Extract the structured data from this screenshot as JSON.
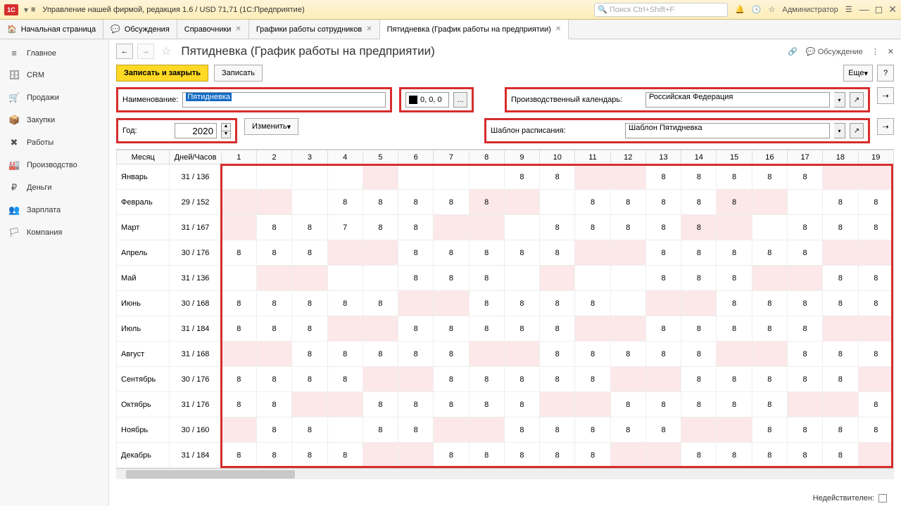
{
  "title": "Управление нашей фирмой, редакция 1.6 / USD 71,71  (1С:Предприятие)",
  "search_placeholder": "Поиск Ctrl+Shift+F",
  "user": "Администратор",
  "tabs": [
    {
      "label": "Начальная страница",
      "closable": false,
      "icon": "🏠"
    },
    {
      "label": "Обсуждения",
      "closable": false,
      "icon": "💬"
    },
    {
      "label": "Справочники",
      "closable": true,
      "icon": ""
    },
    {
      "label": "Графики работы сотрудников",
      "closable": true,
      "icon": ""
    },
    {
      "label": "Пятидневка (График работы на предприятии)",
      "closable": true,
      "icon": "",
      "active": true
    }
  ],
  "sidebar": [
    {
      "icon": "≡",
      "label": "Главное"
    },
    {
      "icon": "🗄",
      "label": "CRM"
    },
    {
      "icon": "🛒",
      "label": "Продажи"
    },
    {
      "icon": "📦",
      "label": "Закупки"
    },
    {
      "icon": "✖",
      "label": "Работы"
    },
    {
      "icon": "🏭",
      "label": "Производство"
    },
    {
      "icon": "₽",
      "label": "Деньги"
    },
    {
      "icon": "👥",
      "label": "Зарплата"
    },
    {
      "icon": "🏳",
      "label": "Компания"
    }
  ],
  "doc_title": "Пятидневка (График работы на предприятии)",
  "head_right": {
    "link": "🔗",
    "discussion": "Обсуждение"
  },
  "toolbar": {
    "save_close": "Записать и закрыть",
    "save": "Записать",
    "more": "Еще",
    "help": "?"
  },
  "form": {
    "name_lbl": "Наименование:",
    "name_val": "Пятидневка",
    "color_val": "0, 0, 0",
    "year_lbl": "Год:",
    "year_val": "2020",
    "change": "Изменить",
    "cal_lbl": "Производственный календарь:",
    "cal_val": "Российская Федерация",
    "tpl_lbl": "Шаблон расписания:",
    "tpl_val": "Шаблон Пятидневка"
  },
  "grid": {
    "h_month": "Месяц",
    "h_dh": "Дней/Часов",
    "days": [
      "1",
      "2",
      "3",
      "4",
      "5",
      "6",
      "7",
      "8",
      "9",
      "10",
      "11",
      "12",
      "13",
      "14",
      "15",
      "16",
      "17",
      "18",
      "19"
    ],
    "rows": [
      {
        "m": "Январь",
        "dh": "31 / 136",
        "p": [
          0,
          0,
          0,
          0,
          1,
          0,
          0,
          0,
          0,
          0,
          1,
          1,
          0,
          0,
          0,
          0,
          0,
          1,
          1
        ],
        "v": [
          "",
          "",
          "",
          "",
          "",
          "",
          "",
          "",
          "8",
          "8",
          "",
          "",
          "8",
          "8",
          "8",
          "8",
          "8",
          "",
          ""
        ]
      },
      {
        "m": "Февраль",
        "dh": "29 / 152",
        "p": [
          1,
          1,
          0,
          0,
          0,
          0,
          0,
          1,
          1,
          0,
          0,
          0,
          0,
          0,
          1,
          1,
          0,
          0,
          0
        ],
        "v": [
          "",
          "",
          "",
          "8",
          "8",
          "8",
          "8",
          "8",
          "",
          "",
          "8",
          "8",
          "8",
          "8",
          "8",
          "",
          "",
          "8",
          "8"
        ]
      },
      {
        "m": "Март",
        "dh": "31 / 167",
        "p": [
          1,
          0,
          0,
          0,
          0,
          0,
          1,
          1,
          0,
          0,
          0,
          0,
          0,
          1,
          1,
          0,
          0,
          0,
          0
        ],
        "v": [
          "",
          "8",
          "8",
          "7",
          "8",
          "8",
          "",
          "",
          "",
          "8",
          "8",
          "8",
          "8",
          "8",
          "",
          "",
          "8",
          "8",
          "8"
        ]
      },
      {
        "m": "Апрель",
        "dh": "30 / 176",
        "p": [
          0,
          0,
          0,
          1,
          1,
          0,
          0,
          0,
          0,
          0,
          1,
          1,
          0,
          0,
          0,
          0,
          0,
          1,
          1
        ],
        "v": [
          "8",
          "8",
          "8",
          "",
          "",
          "8",
          "8",
          "8",
          "8",
          "8",
          "",
          "",
          "8",
          "8",
          "8",
          "8",
          "8",
          "",
          ""
        ]
      },
      {
        "m": "Май",
        "dh": "31 / 136",
        "p": [
          0,
          1,
          1,
          0,
          0,
          0,
          0,
          0,
          0,
          1,
          0,
          0,
          0,
          0,
          0,
          1,
          1,
          0,
          0
        ],
        "v": [
          "",
          "",
          "",
          "",
          "",
          "8",
          "8",
          "8",
          "",
          "",
          "",
          "",
          "8",
          "8",
          "8",
          "",
          "",
          "8",
          "8"
        ]
      },
      {
        "m": "Июнь",
        "dh": "30 / 168",
        "p": [
          0,
          0,
          0,
          0,
          0,
          1,
          1,
          0,
          0,
          0,
          0,
          0,
          1,
          1,
          0,
          0,
          0,
          0,
          0
        ],
        "v": [
          "8",
          "8",
          "8",
          "8",
          "8",
          "",
          "",
          "8",
          "8",
          "8",
          "8",
          "",
          "",
          "",
          "8",
          "8",
          "8",
          "8",
          "8"
        ]
      },
      {
        "m": "Июль",
        "dh": "31 / 184",
        "p": [
          0,
          0,
          0,
          1,
          1,
          0,
          0,
          0,
          0,
          0,
          1,
          1,
          0,
          0,
          0,
          0,
          0,
          1,
          1
        ],
        "v": [
          "8",
          "8",
          "8",
          "",
          "",
          "8",
          "8",
          "8",
          "8",
          "8",
          "",
          "",
          "8",
          "8",
          "8",
          "8",
          "8",
          "",
          ""
        ]
      },
      {
        "m": "Август",
        "dh": "31 / 168",
        "p": [
          1,
          1,
          0,
          0,
          0,
          0,
          0,
          1,
          1,
          0,
          0,
          0,
          0,
          0,
          1,
          1,
          0,
          0,
          0
        ],
        "v": [
          "",
          "",
          "8",
          "8",
          "8",
          "8",
          "8",
          "",
          "",
          "8",
          "8",
          "8",
          "8",
          "8",
          "",
          "",
          "8",
          "8",
          "8"
        ]
      },
      {
        "m": "Сентябрь",
        "dh": "30 / 176",
        "p": [
          0,
          0,
          0,
          0,
          1,
          1,
          0,
          0,
          0,
          0,
          0,
          1,
          1,
          0,
          0,
          0,
          0,
          0,
          1
        ],
        "v": [
          "8",
          "8",
          "8",
          "8",
          "",
          "",
          "8",
          "8",
          "8",
          "8",
          "8",
          "",
          "",
          "8",
          "8",
          "8",
          "8",
          "8",
          ""
        ]
      },
      {
        "m": "Октябрь",
        "dh": "31 / 176",
        "p": [
          0,
          0,
          1,
          1,
          0,
          0,
          0,
          0,
          0,
          1,
          1,
          0,
          0,
          0,
          0,
          0,
          1,
          1,
          0
        ],
        "v": [
          "8",
          "8",
          "",
          "",
          "8",
          "8",
          "8",
          "8",
          "8",
          "",
          "",
          "8",
          "8",
          "8",
          "8",
          "8",
          "",
          "",
          "8"
        ]
      },
      {
        "m": "Ноябрь",
        "dh": "30 / 160",
        "p": [
          1,
          0,
          0,
          0,
          0,
          0,
          1,
          1,
          0,
          0,
          0,
          0,
          0,
          1,
          1,
          0,
          0,
          0,
          0
        ],
        "v": [
          "",
          "8",
          "8",
          "",
          "8",
          "8",
          "",
          "",
          "8",
          "8",
          "8",
          "8",
          "8",
          "",
          "",
          "8",
          "8",
          "8",
          "8"
        ]
      },
      {
        "m": "Декабрь",
        "dh": "31 / 184",
        "p": [
          0,
          0,
          0,
          0,
          1,
          1,
          0,
          0,
          0,
          0,
          0,
          1,
          1,
          0,
          0,
          0,
          0,
          0,
          1
        ],
        "v": [
          "8",
          "8",
          "8",
          "8",
          "",
          "",
          "8",
          "8",
          "8",
          "8",
          "8",
          "",
          "",
          "8",
          "8",
          "8",
          "8",
          "8",
          ""
        ]
      }
    ]
  },
  "status": "Недействителен:"
}
